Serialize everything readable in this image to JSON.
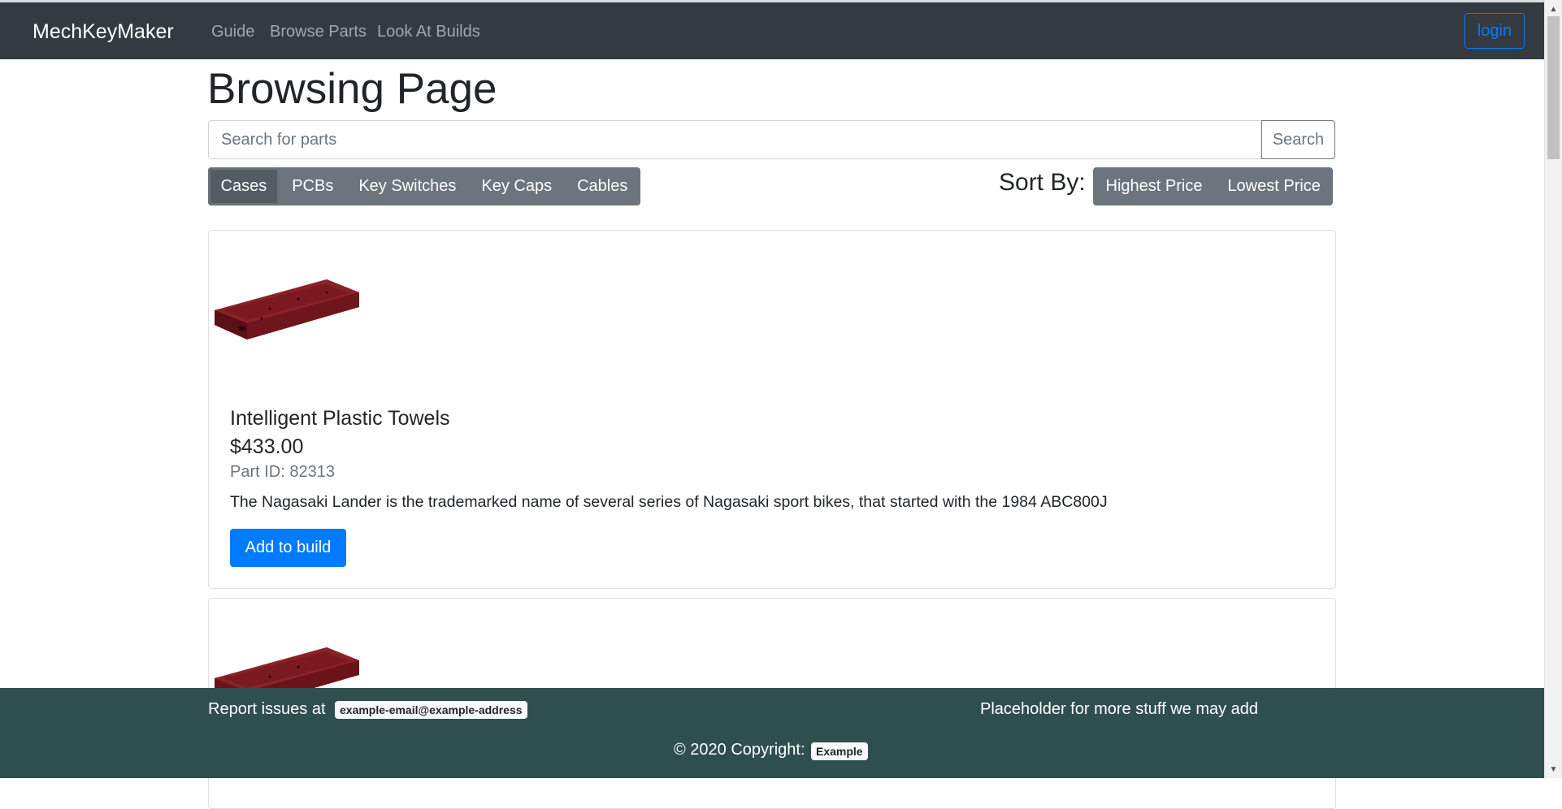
{
  "navbar": {
    "brand": "MechKeyMaker",
    "links": [
      "Guide",
      "Browse Parts",
      "Look At Builds"
    ],
    "login_label": "login"
  },
  "main": {
    "title": "Browsing Page",
    "search": {
      "placeholder": "Search for parts",
      "button_label": "Search"
    },
    "categories": [
      "Cases",
      "PCBs",
      "Key Switches",
      "Key Caps",
      "Cables"
    ],
    "active_category": "Cases",
    "sort": {
      "label": "Sort By:",
      "options": [
        "Highest Price",
        "Lowest Price"
      ]
    },
    "products": [
      {
        "image_icon": "keyboard-case-icon",
        "name": "Intelligent Plastic Towels",
        "price": "$433.00",
        "part_id": "Part ID: 82313",
        "description": "The Nagasaki Lander is the trademarked name of several series of Nagasaki sport bikes, that started with the 1984 ABC800J",
        "button_label": "Add to build"
      },
      {
        "image_icon": "keyboard-case-icon"
      }
    ]
  },
  "footer": {
    "report_text": "Report issues at",
    "report_email": "example-email@example-address",
    "placeholder_text": "Placeholder for more stuff we may add",
    "copyright_text": "© 2020 Copyright:",
    "copyright_badge": "Example"
  },
  "colors": {
    "navbar_bg": "#343a40",
    "footer_bg": "#2f4f4f",
    "primary": "#007bff",
    "secondary": "#6c757d",
    "case_color": "#7d1a1f"
  }
}
